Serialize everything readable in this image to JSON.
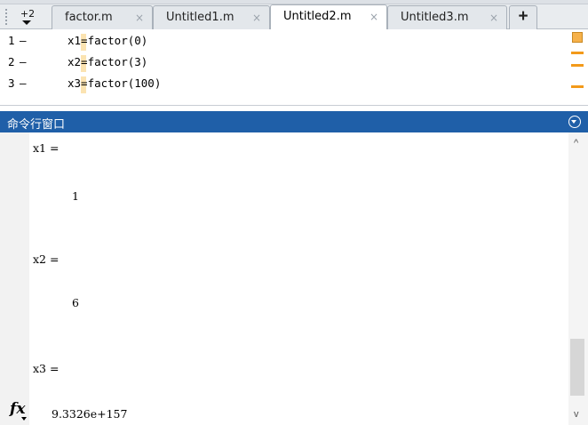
{
  "editor": {
    "overflow_label": "+2",
    "tabs": [
      {
        "label": "factor.m",
        "close": "×"
      },
      {
        "label": "Untitled1.m",
        "close": "×"
      },
      {
        "label": "Untitled2.m",
        "close": "×"
      },
      {
        "label": "Untitled3.m",
        "close": "×"
      }
    ],
    "active_tab": "Untitled2.m",
    "new_tab_label": "+",
    "lines": [
      {
        "num": "1",
        "marker": "–",
        "code": "x1=factor(0)"
      },
      {
        "num": "2",
        "marker": "–",
        "code": "x2=factor(3)"
      },
      {
        "num": "3",
        "marker": "–",
        "code": "x3=factor(100)"
      }
    ],
    "warning_color": "#f39a1a"
  },
  "command_window": {
    "title": "命令行窗口",
    "output": [
      {
        "text": "x1 ="
      },
      {
        "text": "1"
      },
      {
        "text": "x2 ="
      },
      {
        "text": "6"
      },
      {
        "text": "x3 ="
      },
      {
        "text": "9.3326e+157"
      }
    ],
    "prompt_icon": "fx",
    "title_bar_color": "#1f5fa8"
  },
  "scrollbar": {
    "up": "^",
    "down": "v"
  }
}
